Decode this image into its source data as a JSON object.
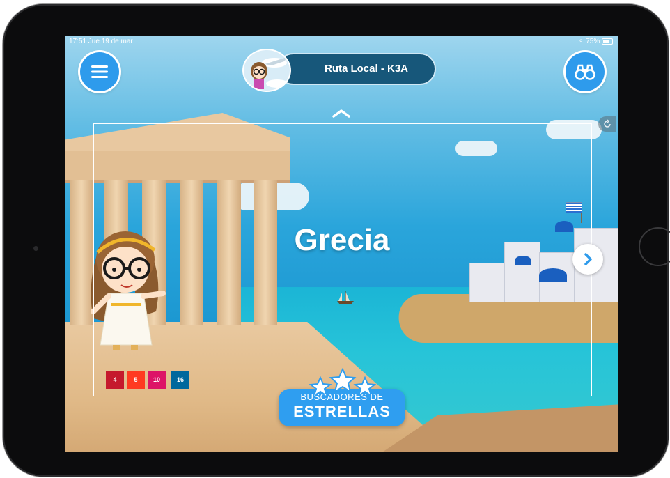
{
  "status_bar": {
    "time_date": "17:51  Jue 19 de mar",
    "battery": "75%"
  },
  "header": {
    "route_title": "Ruta Local - K3A"
  },
  "main": {
    "country_name": "Grecia"
  },
  "badge": {
    "line1": "BUSCADORES DE",
    "line2": "ESTRELLAS"
  },
  "sdg_badges": [
    {
      "number": "4",
      "color": "#c5192d"
    },
    {
      "number": "5",
      "color": "#ff3a21"
    },
    {
      "number": "10",
      "color": "#dd1367"
    },
    {
      "number": "16",
      "color": "#00689d"
    }
  ],
  "icons": {
    "menu": "hamburger-menu-icon",
    "binoculars": "binoculars-icon",
    "next": "chevron-right-icon",
    "collapse": "chevron-up-icon",
    "rotate": "rotate-icon"
  },
  "colors": {
    "accent_blue": "#2e9bec",
    "pill_bg": "#17577a"
  }
}
